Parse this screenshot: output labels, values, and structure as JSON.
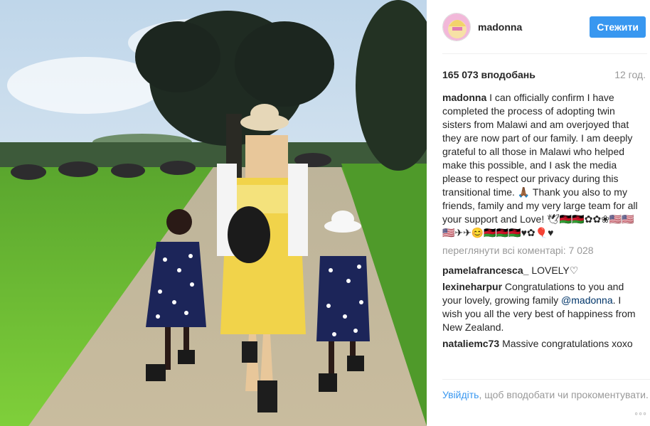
{
  "post": {
    "username": "madonna",
    "follow_label": "Стежити",
    "likes": "165 073 вподобань",
    "time_ago": "12 год.",
    "caption": {
      "username": "madonna",
      "text": "I can officially confirm I have completed the process of adopting twin sisters from Malawi and am overjoyed that they are now part of our family. I am deeply grateful to all those in Malawi who helped make this possible, and I ask the media please to respect our privacy during this transitional time. 🙏🏾 Thank you also to my friends, family and my very large team for all your support and Love! 🕊🇲🇼🇲🇼✿✿❀🇺🇸🇺🇸🇺🇸✈✈😊🇲🇼🇲🇼🇲🇼♥✿🎈♥"
    },
    "view_all": "переглянути всі коментарі: 7 028",
    "comments": [
      {
        "username": "pamelafrancesca_",
        "text": "LOVELY♡",
        "mention": "",
        "text_after": ""
      },
      {
        "username": "lexineharpur",
        "text": "Congratulations to you and your lovely, growing family ",
        "mention": "@madonna",
        "text_after": ". I wish you all the very best of happiness from New Zealand."
      },
      {
        "username": "nataliemc73",
        "text": "Massive congratulations xoxo",
        "mention": "",
        "text_after": ""
      }
    ],
    "footer": {
      "login_link": "Увійдіть",
      "login_rest": ", щоб вподобати чи прокоментувати."
    },
    "more_label": "◦◦◦",
    "colors": {
      "accent": "#3897f0",
      "meta": "#999999",
      "text": "#262626",
      "mention": "#003569"
    }
  }
}
